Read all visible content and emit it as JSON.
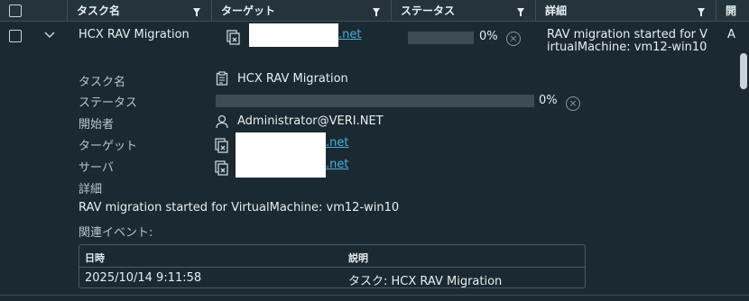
{
  "header": {
    "columns": [
      "タスク名",
      "ターゲット",
      "ステータス",
      "詳細",
      "開"
    ]
  },
  "row": {
    "task_name": "HCX RAV Migration",
    "target_suffix": ".net",
    "progress_percent": 0,
    "progress_text": "0%",
    "detail_line1": "RAV migration started for V",
    "detail_line2": "irtualMachine: vm12-win10",
    "extra_col": "A"
  },
  "details": {
    "task_name_label": "タスク名",
    "task_name_value": "HCX RAV Migration",
    "status_label": "ステータス",
    "status_progress_text": "0%",
    "initiator_label": "開始者",
    "initiator_value": "Administrator@VERI.NET",
    "target_label": "ターゲット",
    "target_suffix": ".net",
    "server_label": "サーバ",
    "server_suffix": ".net",
    "detail_label": "詳細",
    "detail_value": "RAV migration started for VirtualMachine: vm12-win10",
    "related_events_label": "関連イベント:"
  },
  "events": {
    "headers": [
      "日時",
      "説明"
    ],
    "rows": [
      [
        "2025/10/14 9:11:58",
        "タスク: HCX RAV Migration"
      ]
    ]
  },
  "icons": {
    "task": "clipboard-icon",
    "user": "user-icon",
    "vm": "vm-icon",
    "filter": "filter-icon",
    "cancel": "cancel-icon",
    "expand": "chevron-down-icon"
  },
  "colors": {
    "background": "#1b2a32",
    "header": "#25343c",
    "link": "#49afd9",
    "progress_track": "#3d4c55"
  }
}
